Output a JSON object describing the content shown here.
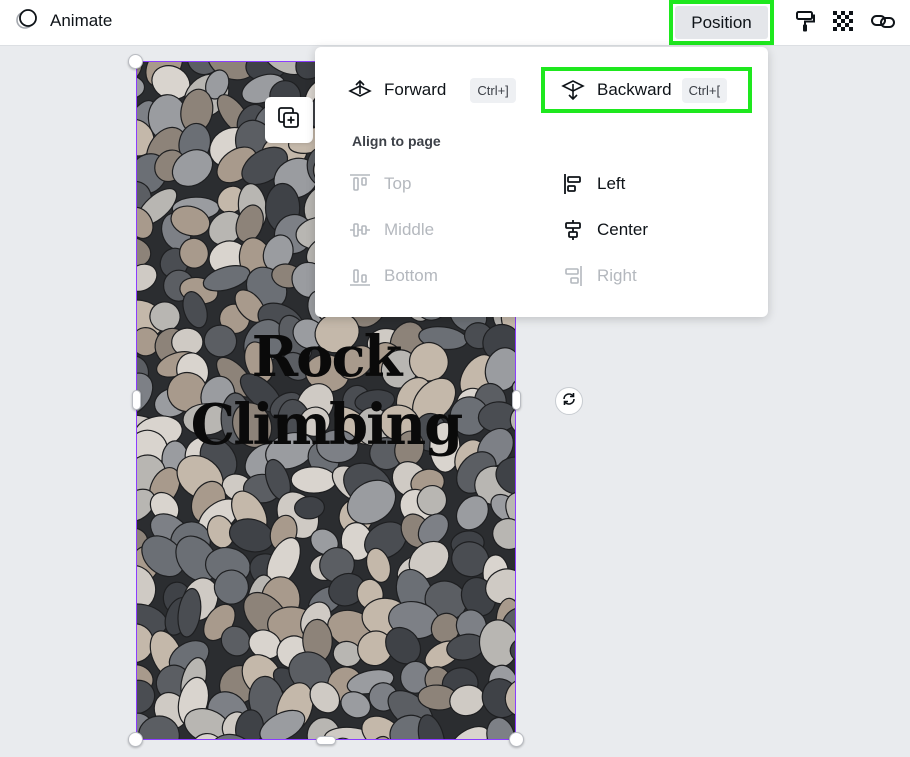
{
  "toolbar": {
    "animate_label": "Animate",
    "position_label": "Position"
  },
  "design": {
    "title_line1": "Rock",
    "title_line2": "Climbing"
  },
  "position_menu": {
    "forward": {
      "label": "Forward",
      "shortcut": "Ctrl+]"
    },
    "backward": {
      "label": "Backward",
      "shortcut": "Ctrl+["
    },
    "align_heading": "Align to page",
    "align_items": {
      "top": "Top",
      "middle": "Middle",
      "bottom": "Bottom",
      "left": "Left",
      "center": "Center",
      "right": "Right"
    }
  },
  "colors": {
    "highlight": "#1ee81e",
    "selection": "#8b3dff",
    "disabled_text": "#b4b8be"
  }
}
